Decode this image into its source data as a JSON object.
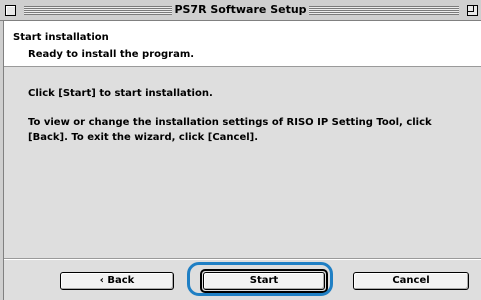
{
  "window": {
    "title": "PS7R Software Setup"
  },
  "header": {
    "title": "Start installation",
    "subtitle": "Ready to install the program."
  },
  "content": {
    "paragraph1": "Click [Start] to start installation.",
    "paragraph2": "To view or change the installation settings of RISO IP Setting Tool, click [Back]. To exit the wizard, click [Cancel]."
  },
  "buttons": {
    "back": "‹ Back",
    "start": "Start",
    "cancel": "Cancel"
  },
  "colors": {
    "highlight": "#1f7fc4"
  }
}
